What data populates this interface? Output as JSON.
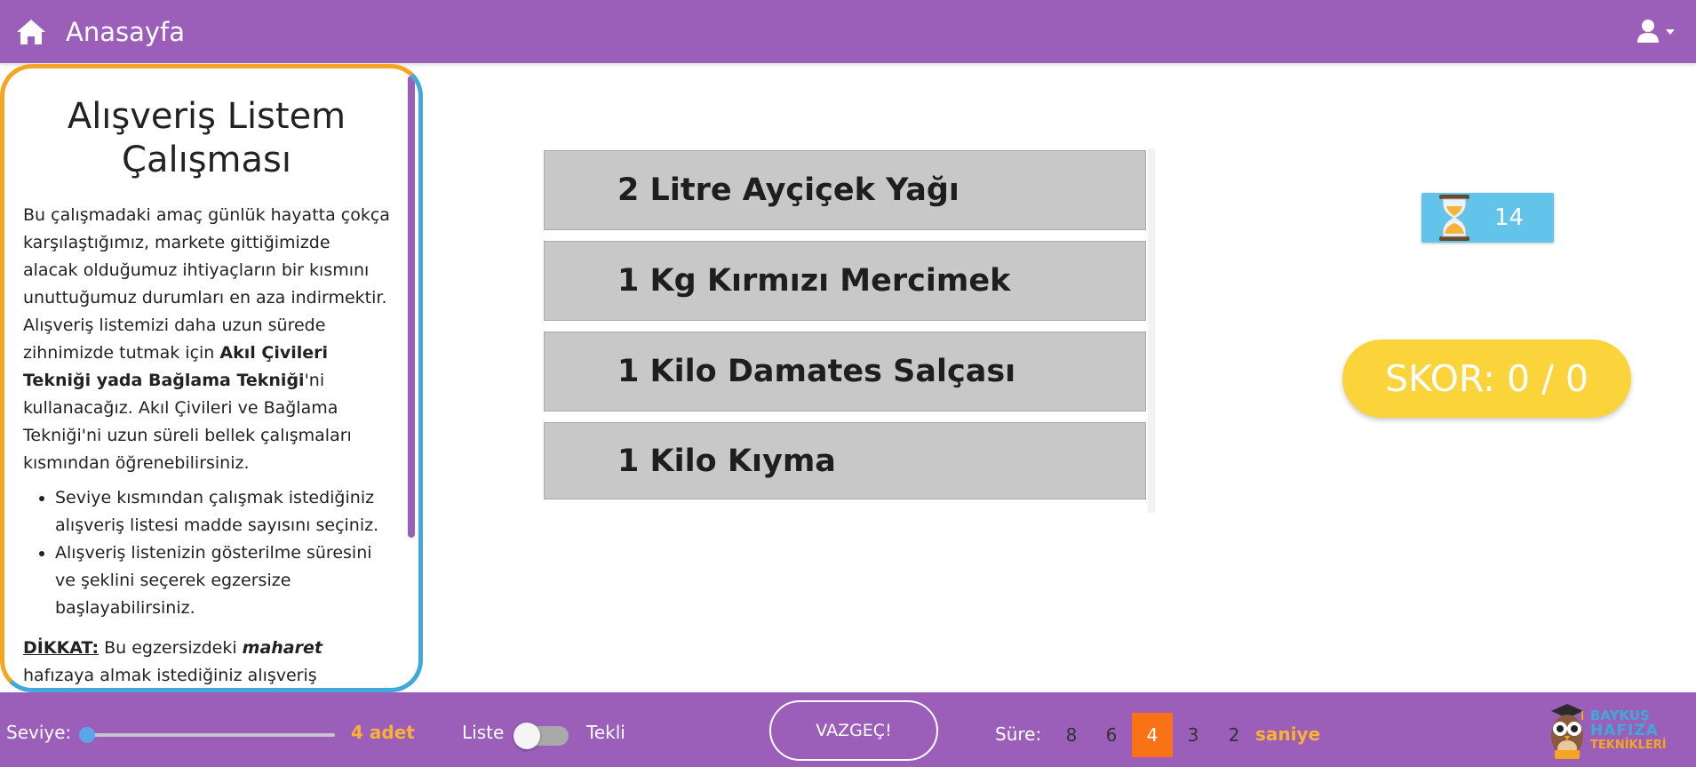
{
  "header": {
    "title": "Anasayfa",
    "home_icon": "home-icon",
    "user_icon": "user-icon"
  },
  "info": {
    "title": "Alışveriş Listem Çalışması",
    "para1_a": "Bu çalışmadaki amaç günlük hayatta çokça karşılaştığımız, markete gittiğimizde alacak olduğumuz ihtiyaçların bir kısmını unuttuğumuz durumları en aza indirmektir. Alışveriş listemizi daha uzun sürede zihnimizde tutmak için ",
    "para1_bold": "Akıl Çivileri Tekniği yada Bağlama Tekniği",
    "para1_b": "'ni kullanacağız. Akıl Çivileri ve Bağlama Tekniği'ni uzun süreli bellek çalışmaları kısmından öğrenebilirsiniz.",
    "bullets": [
      "Seviye kısmından çalışmak istediğiniz alışveriş listesi madde sayısını seçiniz.",
      "Alışveriş listenizin gösterilme süresini ve şeklini seçerek egzersize başlayabilirsiniz."
    ],
    "warning_label": "DİKKAT:",
    "warning_a": " Bu egzersizdeki ",
    "warning_em": "maharet",
    "warning_b": " hafızaya almak istediğiniz alışveriş listenizdeki ihtiyaçlarınızı, hafıza tekniklerinin en temel"
  },
  "shopping_list": {
    "items": [
      "2 Litre Ayçiçek Yağı",
      "1 Kg Kırmızı Mercimek",
      "1 Kilo Damates Salçası",
      "1 Kilo Kıyma"
    ]
  },
  "timer": {
    "value": "14",
    "icon": "hourglass-icon"
  },
  "score": {
    "text": "SKOR: 0 / 0"
  },
  "controls": {
    "level_label": "Seviye:",
    "level_value": "4 adet",
    "level_position": 0,
    "mode_left": "Liste",
    "mode_right": "Tekli",
    "cancel_label": "VAZGEÇ!",
    "duration_label": "Süre:",
    "duration_options": [
      "8",
      "6",
      "4",
      "3",
      "2"
    ],
    "duration_selected": "4",
    "duration_unit": "saniye"
  },
  "logo": {
    "line1": "BAYKUŞ",
    "line2": "HAFIZA",
    "line3": "TEKNİKLERİ"
  },
  "colors": {
    "brand_purple": "#9b5fb9",
    "accent_orange": "#f97316",
    "score_yellow": "#fad43a",
    "timer_blue": "#62c4ea",
    "highlight_gold": "#f9b233"
  }
}
